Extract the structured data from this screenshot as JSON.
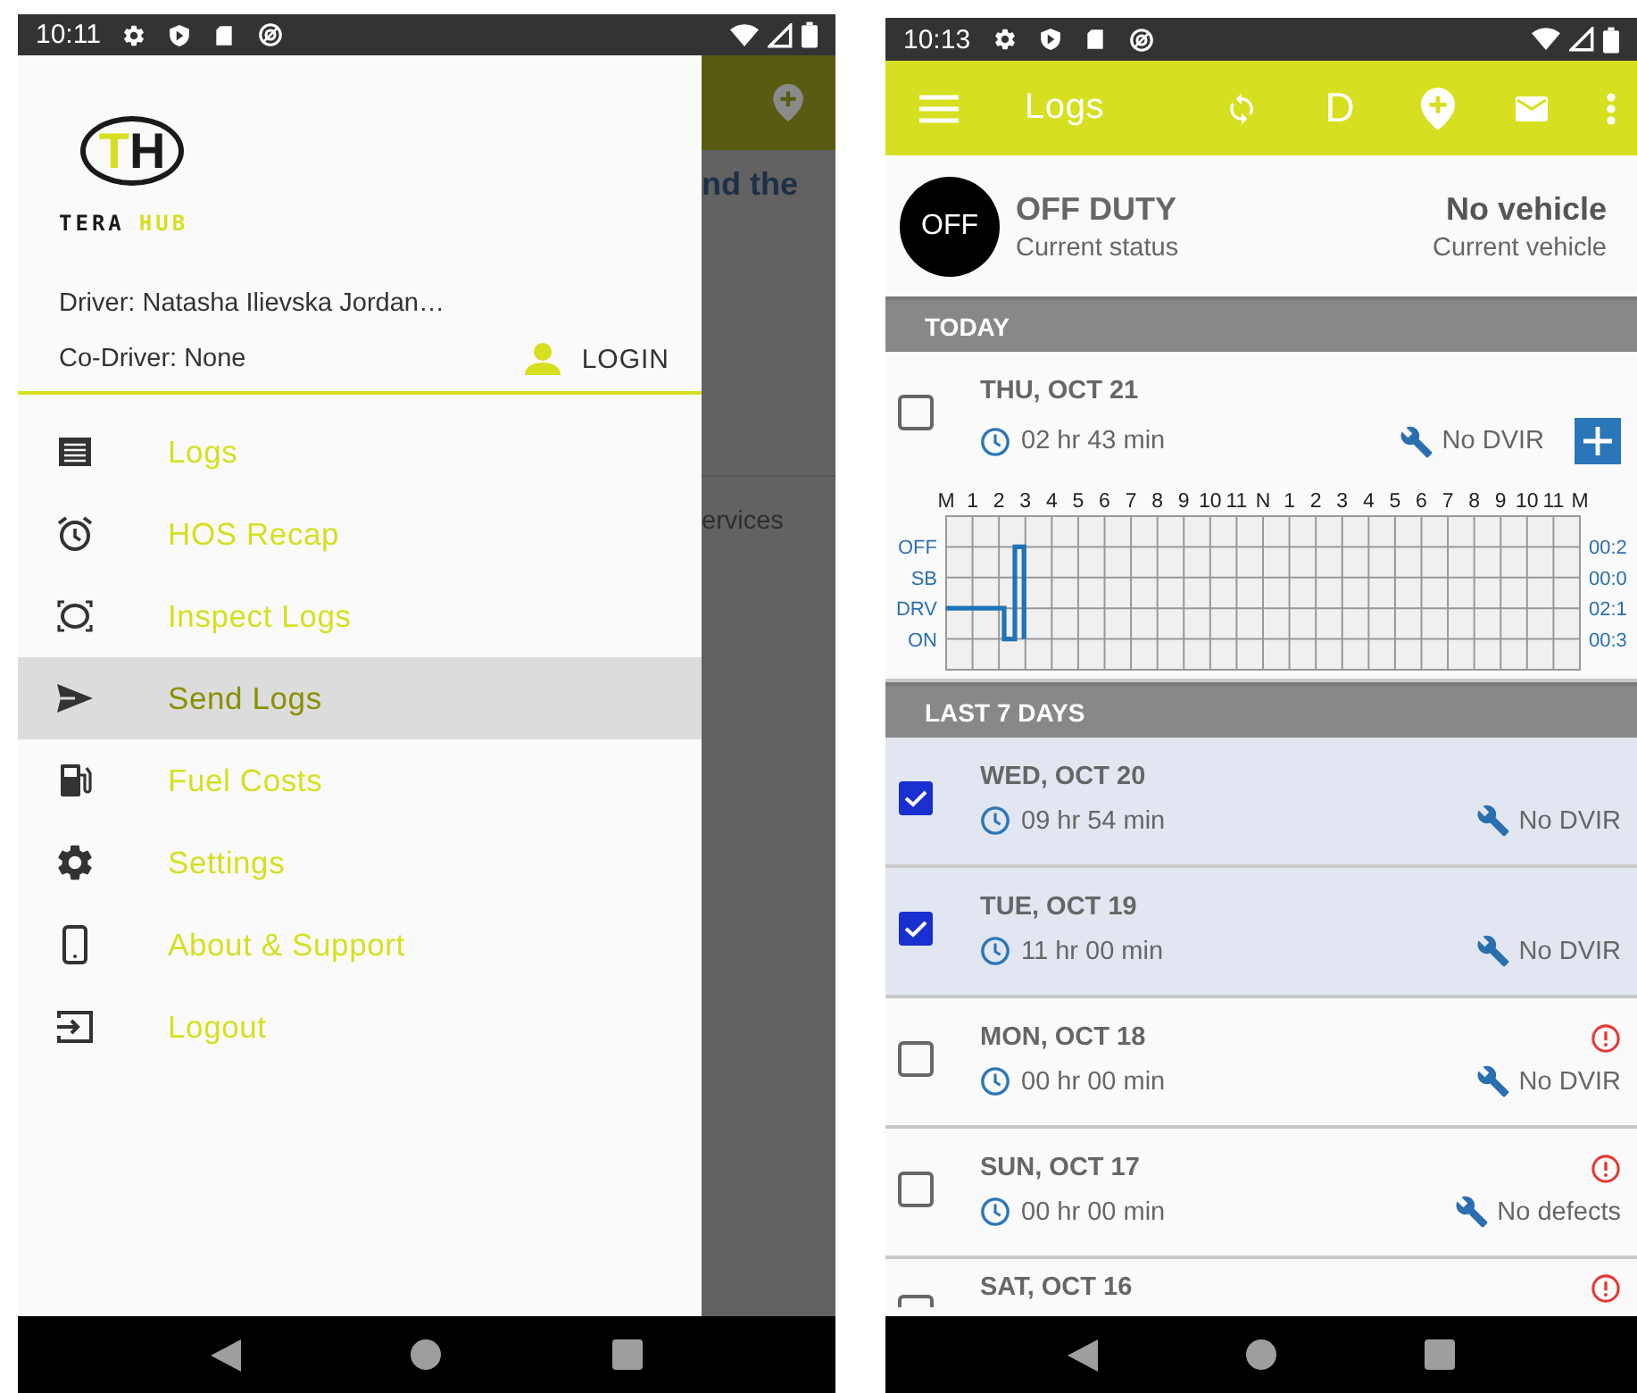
{
  "left_phone": {
    "status_bar": {
      "time": "10:11"
    },
    "background_screen": {
      "texts": [
        "nd the",
        "ervices"
      ]
    },
    "drawer": {
      "logo": {
        "mark": [
          "T",
          "H"
        ],
        "words": [
          "TERA",
          "HUB"
        ]
      },
      "driver": "Driver: Natasha Ilievska Jordan…",
      "co_driver": "Co-Driver: None",
      "login_button": "LOGIN",
      "menu": [
        {
          "kind": "logs",
          "label": "Logs",
          "selected": false
        },
        {
          "kind": "alarm",
          "label": "HOS Recap",
          "selected": false
        },
        {
          "kind": "inspect",
          "label": "Inspect Logs",
          "selected": false
        },
        {
          "kind": "send",
          "label": "Send Logs",
          "selected": true
        },
        {
          "kind": "fuel",
          "label": "Fuel Costs",
          "selected": false
        },
        {
          "kind": "settings",
          "label": "Settings",
          "selected": false
        },
        {
          "kind": "phone",
          "label": "About & Support",
          "selected": false
        },
        {
          "kind": "logout",
          "label": "Logout",
          "selected": false
        }
      ]
    }
  },
  "right_phone": {
    "status_bar": {
      "time": "10:13"
    },
    "app_bar": {
      "title": "Logs",
      "driver_button": "D"
    },
    "status_card": {
      "badge": "OFF",
      "status": "OFF DUTY",
      "status_caption": "Current status",
      "vehicle": "No vehicle",
      "vehicle_caption": "Current vehicle"
    },
    "sections": [
      {
        "title": "TODAY",
        "entries": [
          {
            "date": "THU, OCT 21",
            "duration": "02 hr 43 min",
            "dvir": "No DVIR",
            "checked": false,
            "warning": false,
            "add_button": true,
            "duty_graph": {
              "hour_labels": [
                "M",
                "1",
                "2",
                "3",
                "4",
                "5",
                "6",
                "7",
                "8",
                "9",
                "10",
                "11",
                "N",
                "1",
                "2",
                "3",
                "4",
                "5",
                "6",
                "7",
                "8",
                "9",
                "10",
                "11",
                "M"
              ],
              "status_labels": [
                "OFF",
                "SB",
                "DRV",
                "ON"
              ],
              "totals": [
                "00:2",
                "00:0",
                "02:1",
                "00:3"
              ]
            }
          }
        ]
      },
      {
        "title": "LAST 7 DAYS",
        "entries": [
          {
            "date": "WED, OCT 20",
            "duration": "09 hr 54 min",
            "dvir": "No DVIR",
            "checked": true,
            "warning": false
          },
          {
            "date": "TUE, OCT 19",
            "duration": "11 hr 00 min",
            "dvir": "No DVIR",
            "checked": true,
            "warning": false
          },
          {
            "date": "MON, OCT 18",
            "duration": "00 hr 00 min",
            "dvir": "No DVIR",
            "checked": false,
            "warning": true
          },
          {
            "date": "SUN, OCT 17",
            "duration": "00 hr 00 min",
            "dvir": "No defects",
            "checked": false,
            "warning": true
          },
          {
            "date": "SAT, OCT 16",
            "checked": false,
            "warning": true
          }
        ]
      }
    ]
  }
}
